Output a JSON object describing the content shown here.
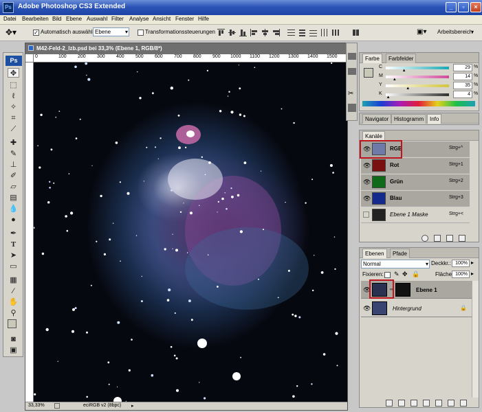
{
  "window": {
    "title": "Adobe Photoshop CS3 Extended",
    "icon": "Ps"
  },
  "menu": [
    "Datei",
    "Bearbeiten",
    "Bild",
    "Ebene",
    "Auswahl",
    "Filter",
    "Analyse",
    "Ansicht",
    "Fenster",
    "Hilfe"
  ],
  "options": {
    "auto_select_label": "Automatisch auswählen:",
    "auto_select_value": "Ebene",
    "transform_label": "Transformationssteuerungen",
    "workspace_label": "Arbeitsbereich"
  },
  "tools": {
    "logo": "Ps"
  },
  "document": {
    "title": "M42-Feld-2_lzb.psd bei 33,3% (Ebene 1, RGB/8*)",
    "ruler_labels": [
      "0",
      "100",
      "200",
      "300",
      "400",
      "500",
      "600",
      "700",
      "800",
      "900",
      "1000",
      "1100",
      "1200",
      "1300",
      "1400",
      "1500"
    ],
    "zoom": "33,33%",
    "profile": "eciRGB v2 (8bpc)"
  },
  "color_panel": {
    "tabs": [
      "Farbe",
      "Farbfelder"
    ],
    "rows": [
      {
        "label": "C",
        "value": "29",
        "unit": "%",
        "fill": 0.29,
        "color": "#17a9b5"
      },
      {
        "label": "M",
        "value": "14",
        "unit": "%",
        "fill": 0.14,
        "color": "#d0479a"
      },
      {
        "label": "Y",
        "value": "35",
        "unit": "%",
        "fill": 0.35,
        "color": "#d1c43c"
      },
      {
        "label": "K",
        "value": "4",
        "unit": "%",
        "fill": 0.04,
        "color": "#2f2f2f"
      }
    ]
  },
  "nav_panel": {
    "tabs": [
      "Navigator",
      "Histogramm",
      "Info"
    ]
  },
  "channels_panel": {
    "tabs": [
      "Kanäle"
    ],
    "rows": [
      {
        "name": "RGB",
        "shortcut": "Strg+^",
        "thumb": "#6f7aa8"
      },
      {
        "name": "Rot",
        "shortcut": "Strg+1",
        "thumb": "#7a1010"
      },
      {
        "name": "Grün",
        "shortcut": "Strg+2",
        "thumb": "#0f6a1a"
      },
      {
        "name": "Blau",
        "shortcut": "Strg+3",
        "thumb": "#142a8c"
      },
      {
        "name": "Ebene 1 Maske",
        "shortcut": "Strg+<",
        "thumb": "#222"
      }
    ]
  },
  "layers_panel": {
    "tabs": [
      "Ebenen",
      "Pfade"
    ],
    "blend_mode": "Normal",
    "opacity_label": "Deckkr.:",
    "opacity_value": "100%",
    "lock_label": "Fixieren:",
    "fill_label": "Fläche:",
    "fill_value": "100%",
    "layers": [
      {
        "name": "Ebene 1",
        "thumb": "#2a3050"
      },
      {
        "name": "Hintergrund",
        "thumb": "#3a4470"
      }
    ]
  }
}
